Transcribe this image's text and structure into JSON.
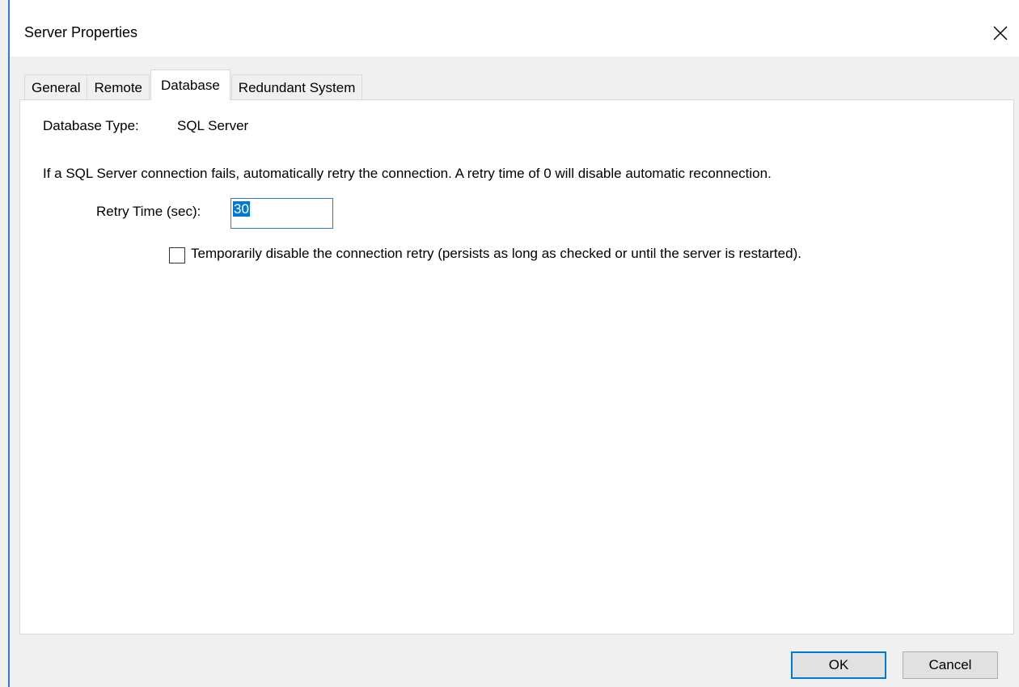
{
  "window": {
    "title": "Server Properties",
    "close_icon": "close-icon"
  },
  "tabs": [
    {
      "label": "General",
      "active": false
    },
    {
      "label": "Remote",
      "active": false
    },
    {
      "label": "Database",
      "active": true
    },
    {
      "label": "Redundant System",
      "active": false
    }
  ],
  "database": {
    "type_label": "Database Type:",
    "type_value": "SQL Server",
    "info_text": "If a SQL Server connection fails, automatically retry the connection. A retry time of 0 will disable automatic reconnection.",
    "retry_label": "Retry Time (sec):",
    "retry_value": "30",
    "disable_retry_label": "Temporarily disable the connection retry (persists as long as checked or until the server is restarted).",
    "disable_retry_checked": false
  },
  "buttons": {
    "ok_label": "OK",
    "cancel_label": "Cancel"
  },
  "colors": {
    "accent": "#0078d7",
    "window_bg": "#f0f0f0",
    "panel_bg": "#ffffff"
  }
}
